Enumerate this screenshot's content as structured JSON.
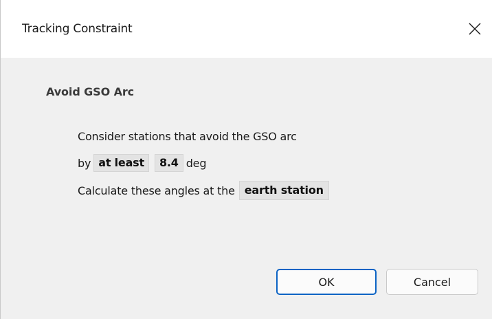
{
  "window": {
    "title": "Tracking Constraint"
  },
  "section": {
    "title": "Avoid GSO Arc"
  },
  "constraint": {
    "line1": "Consider stations that avoid the GSO arc",
    "by_prefix": "by",
    "comparison_value": "at least",
    "angle_value": "8.4",
    "unit": "deg",
    "calc_prefix": "Calculate these angles at the",
    "location_value": "earth station"
  },
  "buttons": {
    "ok_label": "OK",
    "cancel_label": "Cancel"
  },
  "icons": {
    "close": "close-icon"
  },
  "colors": {
    "accent": "#0b63c4",
    "background": "#f0f0f0",
    "titlebar": "#ffffff",
    "chip": "#e3e3e3"
  }
}
